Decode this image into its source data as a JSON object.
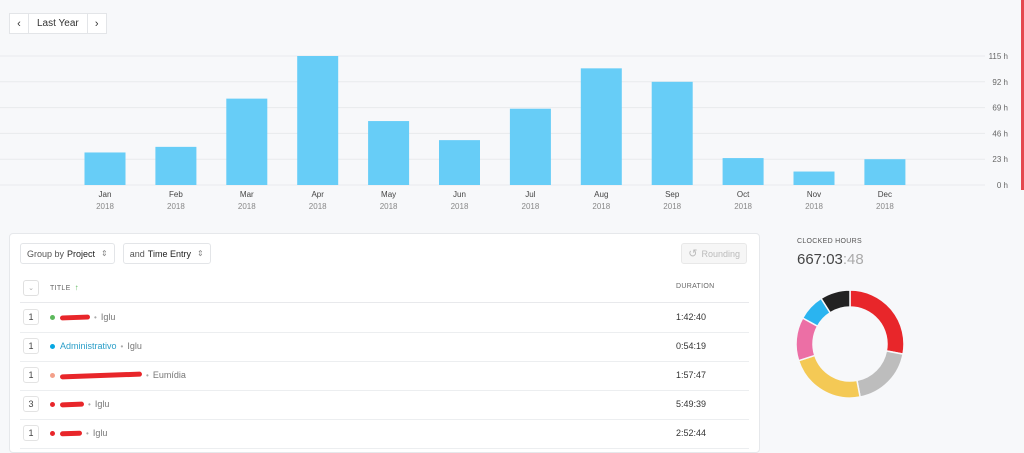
{
  "period": {
    "prev_icon": "‹",
    "label": "Last Year",
    "next_icon": "›"
  },
  "chart_data": {
    "type": "bar",
    "categories": [
      "Jan",
      "Feb",
      "Mar",
      "Apr",
      "May",
      "Jun",
      "Jul",
      "Aug",
      "Sep",
      "Oct",
      "Nov",
      "Dec"
    ],
    "years": [
      "2018",
      "2018",
      "2018",
      "2018",
      "2018",
      "2018",
      "2018",
      "2018",
      "2018",
      "2018",
      "2018",
      "2018"
    ],
    "values": [
      29,
      34,
      77,
      115,
      57,
      40,
      68,
      104,
      92,
      24,
      12,
      23
    ],
    "y_ticks": [
      "0 h",
      "23 h",
      "46 h",
      "69 h",
      "92 h",
      "115 h"
    ],
    "y_tick_values": [
      0,
      23,
      46,
      69,
      92,
      115
    ],
    "ylim": [
      0,
      115
    ],
    "color": "#67cdf7",
    "grid": true
  },
  "toolbar": {
    "group_prefix": "Group by",
    "group_value": "Project",
    "and_prefix": "and",
    "and_value": "Time Entry",
    "chevron": "⇕",
    "rounding_icon": "↺",
    "rounding_label": "Rounding"
  },
  "table": {
    "select_icon": "⌄",
    "col_title": "TITLE",
    "sort_icon": "↑",
    "col_duration": "DURATION",
    "rows": [
      {
        "count": "1",
        "project": "",
        "client": "Iglu",
        "duration": "1:42:40",
        "dot_color": "#5cb85c"
      },
      {
        "count": "1",
        "project": "Administrativo",
        "client": "Iglu",
        "duration": "0:54:19",
        "dot_color": "#06a7e2"
      },
      {
        "count": "1",
        "project": "",
        "client": "Eumídia",
        "duration": "1:57:47",
        "dot_color": "#f3a08a"
      },
      {
        "count": "3",
        "project": "",
        "client": "Iglu",
        "duration": "5:49:39",
        "dot_color": "#e8262a"
      },
      {
        "count": "1",
        "project": "",
        "client": "Iglu",
        "duration": "2:52:44",
        "dot_color": "#e8262a"
      }
    ],
    "separator": "•"
  },
  "summary": {
    "label": "CLOCKED HOURS",
    "value_main": "667:03",
    "value_sec": ":48"
  },
  "donut": {
    "segments": [
      {
        "value": 28,
        "color": "#e8262a"
      },
      {
        "value": 19,
        "color": "#bdbdbd"
      },
      {
        "value": 23,
        "color": "#f4c955"
      },
      {
        "value": 13,
        "color": "#ec6fa5"
      },
      {
        "value": 8,
        "color": "#2ab4f0"
      },
      {
        "value": 9,
        "color": "#222222"
      }
    ]
  }
}
